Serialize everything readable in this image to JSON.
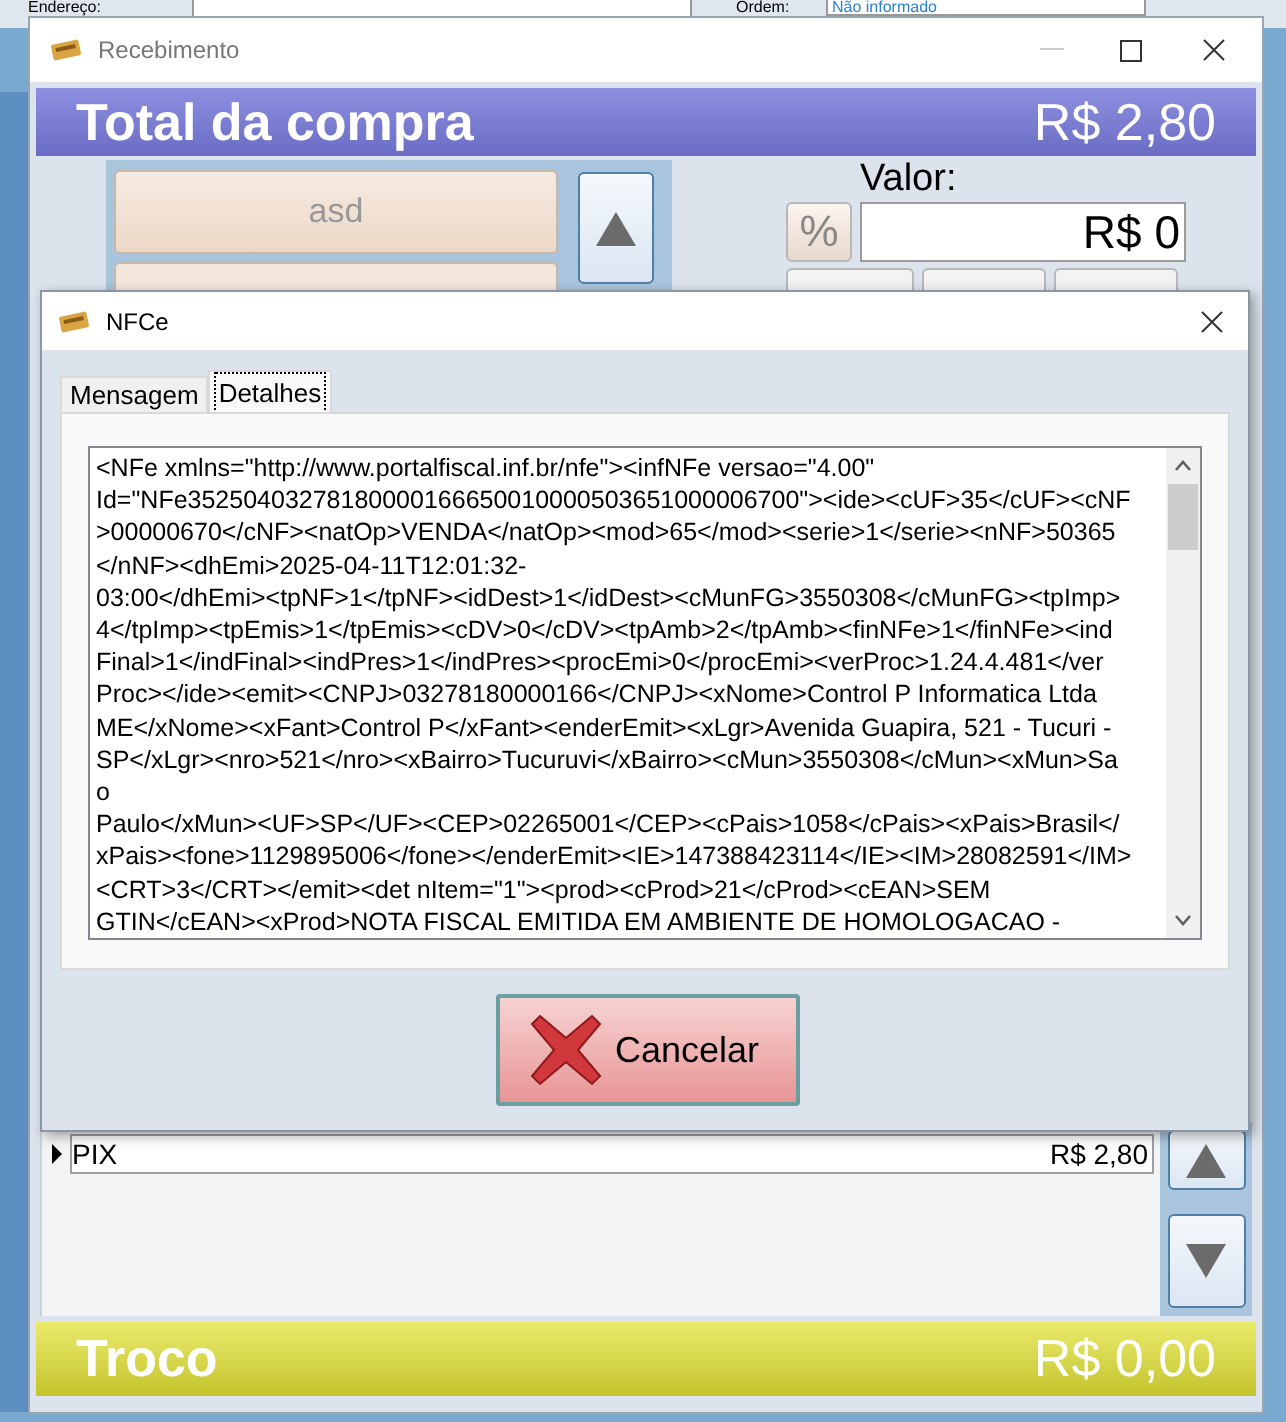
{
  "background": {
    "address_label": "Endereço:",
    "order_label": "Ordem:",
    "order_value": "Não informado"
  },
  "receipt_window": {
    "title": "Recebimento",
    "total_label": "Total da compra",
    "total_value": "R$ 2,80",
    "payment_buttons": [
      "asd"
    ],
    "value_label": "Valor:",
    "percent_button": "%",
    "value_field": "R$ 0",
    "payments": [
      {
        "method": "PIX",
        "amount": "R$ 2,80",
        "selected": true
      }
    ],
    "change_label": "Troco",
    "change_value": "R$ 0,00"
  },
  "dialog": {
    "title": "NFCe",
    "tabs": [
      {
        "label": "Mensagem",
        "selected": false
      },
      {
        "label": "Detalhes",
        "selected": true
      }
    ],
    "xml_lines": [
      "<NFe xmlns=\"http://www.portalfiscal.inf.br/nfe\"><infNFe versao=\"4.00\"",
      "Id=\"NFe35250403278180000166650010000503651000006700\"><ide><cUF>35</cUF><cNF",
      ">00000670</cNF><natOp>VENDA</natOp><mod>65</mod><serie>1</serie><nNF>50365",
      "</nNF><dhEmi>2025-04-11T12:01:32-",
      "03:00</dhEmi><tpNF>1</tpNF><idDest>1</idDest><cMunFG>3550308</cMunFG><tpImp>",
      "4</tpImp><tpEmis>1</tpEmis><cDV>0</cDV><tpAmb>2</tpAmb><finNFe>1</finNFe><ind",
      "Final>1</indFinal><indPres>1</indPres><procEmi>0</procEmi><verProc>1.24.4.481</ver",
      "Proc></ide><emit><CNPJ>03278180000166</CNPJ><xNome>Control P Informatica Ltda",
      "ME</xNome><xFant>Control P</xFant><enderEmit><xLgr>Avenida Guapira, 521 - Tucuri -",
      "SP</xLgr><nro>521</nro><xBairro>Tucuruvi</xBairro><cMun>3550308</cMun><xMun>Sa",
      "o",
      "Paulo</xMun><UF>SP</UF><CEP>02265001</CEP><cPais>1058</cPais><xPais>Brasil</",
      "xPais><fone>1129895006</fone></enderEmit><IE>147388423114</IE><IM>28082591</IM>",
      "<CRT>3</CRT></emit><det nItem=\"1\"><prod><cProd>21</cProd><cEAN>SEM",
      "GTIN</cEAN><xProd>NOTA FISCAL EMITIDA EM AMBIENTE DE HOMOLOGACAO -"
    ],
    "cancel_button": "Cancelar"
  }
}
